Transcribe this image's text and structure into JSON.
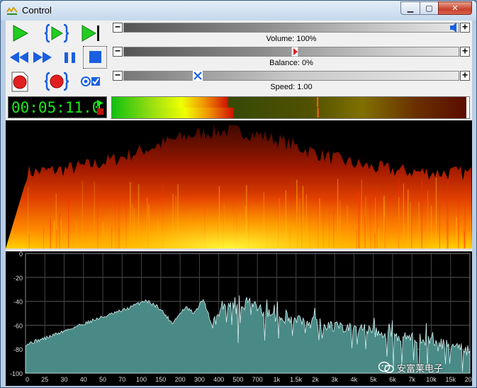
{
  "window": {
    "title": "Control"
  },
  "sliders": {
    "volume": {
      "label": "Volume: 100%",
      "value": 1.0
    },
    "balance": {
      "label": "Balance: 0%",
      "value": 0.5
    },
    "speed": {
      "label": "Speed: 1.00",
      "value": 0.23
    }
  },
  "time": "00:05:11.0",
  "vu": {
    "level": 0.52,
    "peak_left": 0.68,
    "peak_right": 0.65
  },
  "spectrum": {
    "y_ticks": [
      "0",
      "-20",
      "-40",
      "-60",
      "-80",
      "-100"
    ],
    "x_ticks": [
      "0",
      "25",
      "30",
      "40",
      "50",
      "70",
      "100",
      "150",
      "200",
      "300",
      "400",
      "500",
      "700",
      "1k",
      "1.5k",
      "2k",
      "3k",
      "4k",
      "5k",
      "6k",
      "7k",
      "10k",
      "15k",
      "20k"
    ]
  },
  "watermark": {
    "text": "安富莱电子"
  },
  "colors": {
    "play": "#22cc22",
    "transport": "#1a5fe0",
    "record": "#e02020",
    "time": "#19ea19",
    "spectrum_fill": "#4a8a86",
    "spectrum_line": "#cfeeee"
  }
}
